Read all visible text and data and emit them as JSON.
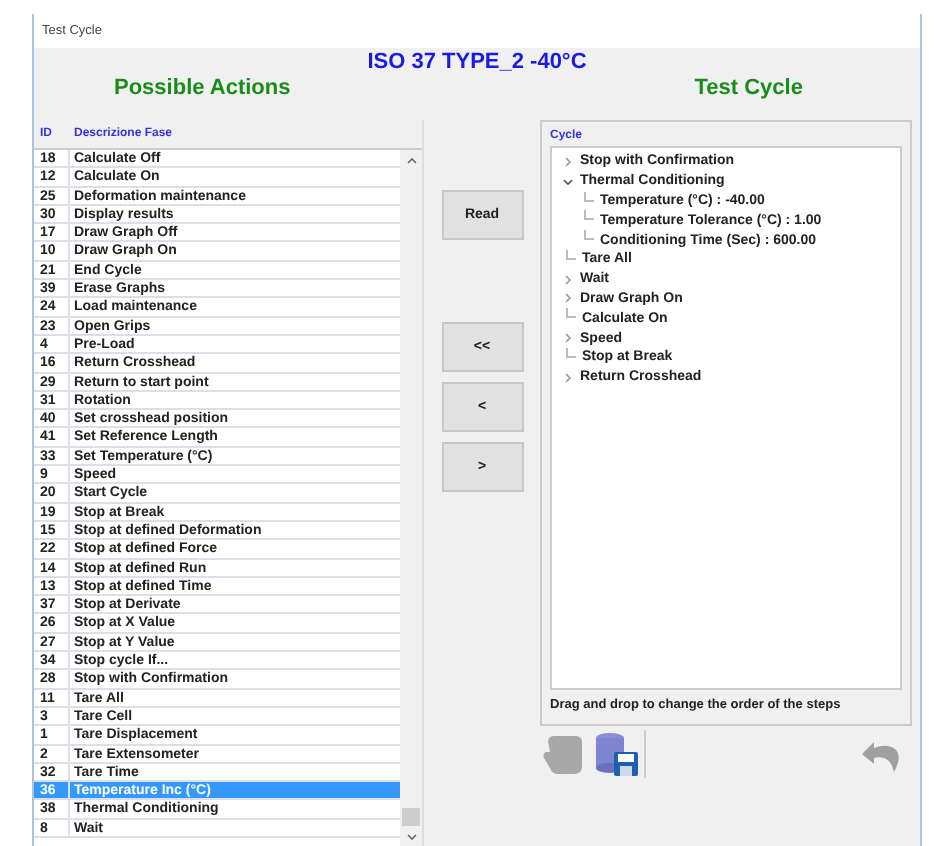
{
  "window": {
    "title": "Test Cycle"
  },
  "header": {
    "title": "ISO 37 TYPE_2 -40°C",
    "left_heading": "Possible Actions",
    "right_heading": "Test Cycle"
  },
  "actions": {
    "columns": [
      "ID",
      "Descrizione Fase"
    ],
    "rows": [
      {
        "id": "18",
        "name": "Calculate Off",
        "selected": false
      },
      {
        "id": "12",
        "name": "Calculate On",
        "selected": false
      },
      {
        "id": "25",
        "name": "Deformation maintenance",
        "selected": false
      },
      {
        "id": "30",
        "name": "Display results",
        "selected": false
      },
      {
        "id": "17",
        "name": "Draw Graph Off",
        "selected": false
      },
      {
        "id": "10",
        "name": "Draw Graph On",
        "selected": false
      },
      {
        "id": "21",
        "name": "End Cycle",
        "selected": false
      },
      {
        "id": "39",
        "name": "Erase Graphs",
        "selected": false
      },
      {
        "id": "24",
        "name": "Load maintenance",
        "selected": false
      },
      {
        "id": "23",
        "name": "Open Grips",
        "selected": false
      },
      {
        "id": "4",
        "name": "Pre-Load",
        "selected": false
      },
      {
        "id": "16",
        "name": "Return Crosshead",
        "selected": false
      },
      {
        "id": "29",
        "name": "Return to start point",
        "selected": false
      },
      {
        "id": "31",
        "name": "Rotation",
        "selected": false
      },
      {
        "id": "40",
        "name": "Set crosshead position",
        "selected": false
      },
      {
        "id": "41",
        "name": "Set Reference Length",
        "selected": false
      },
      {
        "id": "33",
        "name": "Set Temperature (°C)",
        "selected": false
      },
      {
        "id": "9",
        "name": "Speed",
        "selected": false
      },
      {
        "id": "20",
        "name": "Start Cycle",
        "selected": false
      },
      {
        "id": "19",
        "name": "Stop at Break",
        "selected": false
      },
      {
        "id": "15",
        "name": "Stop at defined Deformation",
        "selected": false
      },
      {
        "id": "22",
        "name": "Stop at defined Force",
        "selected": false
      },
      {
        "id": "14",
        "name": "Stop at defined Run",
        "selected": false
      },
      {
        "id": "13",
        "name": "Stop at defined Time",
        "selected": false
      },
      {
        "id": "37",
        "name": "Stop at Derivate",
        "selected": false
      },
      {
        "id": "26",
        "name": "Stop at X Value",
        "selected": false
      },
      {
        "id": "27",
        "name": "Stop at Y Value",
        "selected": false
      },
      {
        "id": "34",
        "name": "Stop cycle If...",
        "selected": false
      },
      {
        "id": "28",
        "name": "Stop with Confirmation",
        "selected": false
      },
      {
        "id": "11",
        "name": "Tare All",
        "selected": false
      },
      {
        "id": "3",
        "name": "Tare Cell",
        "selected": false
      },
      {
        "id": "1",
        "name": "Tare Displacement",
        "selected": false
      },
      {
        "id": "2",
        "name": "Tare Extensometer",
        "selected": false
      },
      {
        "id": "32",
        "name": "Tare Time",
        "selected": false
      },
      {
        "id": "36",
        "name": "Temperature Inc (°C)",
        "selected": true
      },
      {
        "id": "38",
        "name": "Thermal Conditioning",
        "selected": false
      },
      {
        "id": "8",
        "name": "Wait",
        "selected": false
      }
    ]
  },
  "buttons": [
    "Read",
    "<<",
    "<",
    ">"
  ],
  "cycle": {
    "label": "Cycle",
    "items": [
      {
        "label": "Stop with Confirmation",
        "expanded": false
      },
      {
        "label": "Thermal Conditioning",
        "expanded": true,
        "children": [
          {
            "label": "Temperature (°C) : -40.00"
          },
          {
            "label": "Temperature Tolerance (°C) : 1.00"
          },
          {
            "label": "Conditioning Time (Sec) : 600.00"
          }
        ]
      },
      {
        "label": "Tare All"
      },
      {
        "label": "Wait",
        "expanded": false
      },
      {
        "label": "Draw Graph On",
        "expanded": false
      },
      {
        "label": "Calculate On"
      },
      {
        "label": "Speed",
        "expanded": false
      },
      {
        "label": "Stop at Break"
      },
      {
        "label": "Return Crosshead",
        "expanded": false
      }
    ],
    "hint": "Drag and drop to change the order of the steps"
  }
}
